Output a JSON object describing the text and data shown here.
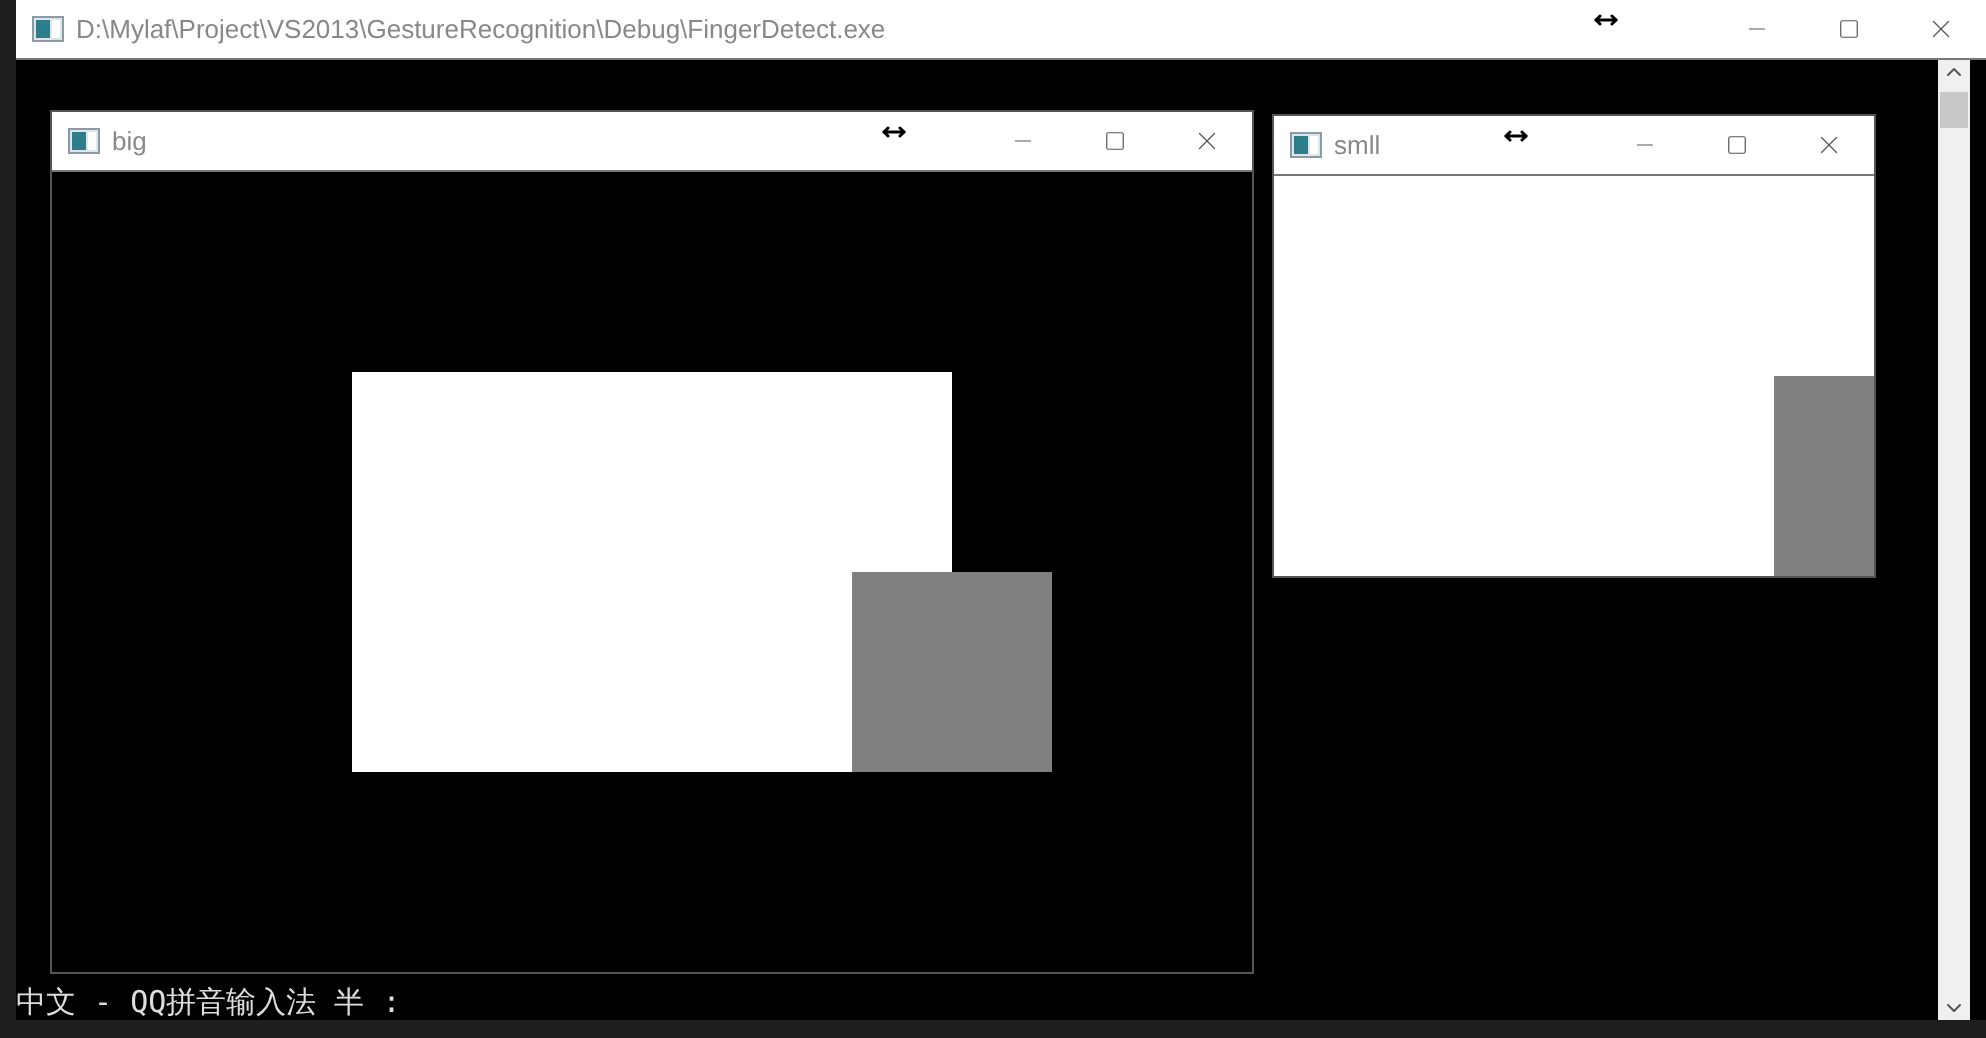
{
  "console": {
    "title": "D:\\Mylaf\\Project\\VS2013\\GestureRecognition\\Debug\\FingerDetect.exe",
    "ime_status": "中文 - QQ拼音输入法 半 :"
  },
  "windows": [
    {
      "title": "big"
    },
    {
      "title": "smll"
    }
  ]
}
